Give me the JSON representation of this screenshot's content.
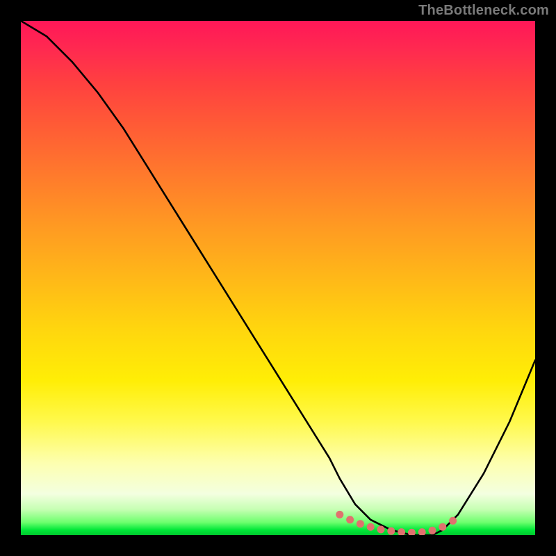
{
  "attribution": "TheBottleneck.com",
  "colors": {
    "background": "#000000",
    "attribution_text": "#7a7a7a",
    "curve_stroke": "#000000",
    "marker_fill": "#e0726e",
    "gradient_stops": [
      "#ff1758",
      "#ff2b4f",
      "#ff4040",
      "#ff5a36",
      "#ff7a2c",
      "#ff9a22",
      "#ffb818",
      "#ffd60e",
      "#ffee06",
      "#fff94d",
      "#fdffb0",
      "#f3ffe0",
      "#c6ffb3",
      "#6eff6e",
      "#00e838",
      "#00c82e"
    ]
  },
  "chart_data": {
    "type": "line",
    "title": "",
    "xlabel": "",
    "ylabel": "",
    "xlim": [
      0,
      100
    ],
    "ylim": [
      0,
      100
    ],
    "grid": false,
    "legend": false,
    "series": [
      {
        "name": "bottleneck-curve",
        "x": [
          0,
          5,
          10,
          15,
          20,
          25,
          30,
          35,
          40,
          45,
          50,
          55,
          60,
          62,
          65,
          68,
          72,
          76,
          80,
          82,
          85,
          90,
          95,
          100
        ],
        "y": [
          100,
          97,
          92,
          86,
          79,
          71,
          63,
          55,
          47,
          39,
          31,
          23,
          15,
          11,
          6,
          3,
          1,
          0,
          0,
          1,
          4,
          12,
          22,
          34
        ]
      }
    ],
    "markers": {
      "name": "optimal-range-dots",
      "x": [
        62,
        64,
        66,
        68,
        70,
        72,
        74,
        76,
        78,
        80,
        82,
        84
      ],
      "y": [
        4.0,
        3.0,
        2.2,
        1.6,
        1.1,
        0.8,
        0.6,
        0.5,
        0.6,
        0.9,
        1.6,
        2.8
      ]
    },
    "annotations": []
  }
}
